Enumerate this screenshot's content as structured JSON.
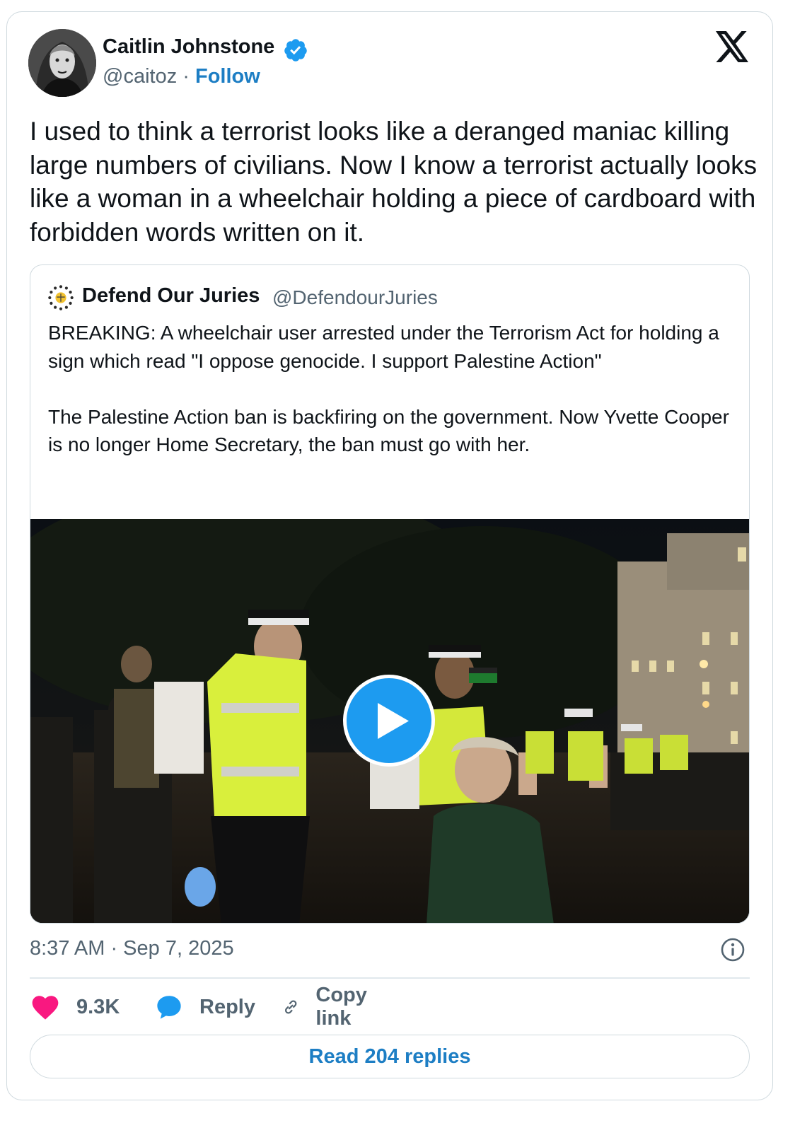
{
  "author": {
    "name": "Caitlin Johnstone",
    "handle": "@caitoz",
    "separator": "·",
    "follow_label": "Follow"
  },
  "tweet": {
    "text": "I used to think a terrorist looks like a deranged maniac killing large numbers of civilians. Now I know a terrorist actually looks like a woman in a wheelchair holding a piece of cardboard with forbidden words written on it."
  },
  "quoted_tweet": {
    "name": "Defend Our Juries",
    "handle": "@DefendourJuries",
    "text": "BREAKING: A wheelchair user arrested under the Terrorism Act for holding a sign which read \"I oppose genocide. I support Palestine Action\"\n\nThe Palestine Action ban is backfiring on the government. Now Yvette Cooper is no longer Home Secretary, the ban must go with her."
  },
  "meta": {
    "timestamp": "8:37 AM · Sep 7, 2025"
  },
  "actions": {
    "likes": "9.3K",
    "reply_label": "Reply",
    "copy_link_label": "Copy link",
    "read_replies_label": "Read 204 replies"
  },
  "colors": {
    "link_blue": "#1d7ec4",
    "play_blue": "#1d9bf0",
    "like_pink": "#f91880",
    "secondary_text": "#536471"
  },
  "icons": [
    "verified-badge-icon",
    "x-logo-icon",
    "play-icon",
    "info-icon",
    "heart-icon",
    "reply-bubble-icon",
    "link-icon"
  ]
}
